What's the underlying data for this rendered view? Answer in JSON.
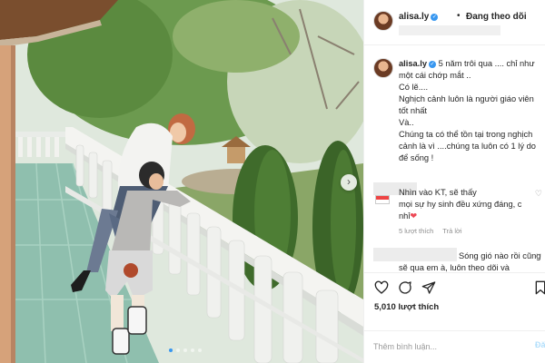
{
  "post": {
    "username": "alisa.ly",
    "separator": "•",
    "follow_status": "Đang theo dõi",
    "caption_lines": [
      "5 năm trôi qua .... chỉ như",
      "một cái chớp mắt ..",
      "Có lẽ....",
      "Nghịch cảnh luôn là người giáo viên",
      "tốt nhất",
      "Và..",
      "Chúng ta có thể tồn tại trong nghịch",
      "cảnh là vì ....chúng ta luôn có 1 lý do",
      "để sống !"
    ],
    "likes": "5,010 lượt thích"
  },
  "comments": [
    {
      "lines": [
        "Nhìn vào KT, sẽ thấy",
        "mọi sự hy sinh đều xứng đáng, c",
        "nhỉ"
      ],
      "heart": "❤",
      "likes_label": "5 lượt thích",
      "reply_label": "Trả lời"
    },
    {
      "lines": [
        "Sóng gió nào rồi cũng",
        "sẽ qua em à, luôn theo dõi và"
      ]
    }
  ],
  "actions": {
    "like_icon": "heart-outline-icon",
    "comment_icon": "comment-icon",
    "share_icon": "send-icon",
    "save_icon": "bookmark-icon"
  },
  "add_comment": {
    "placeholder": "Thêm bình luận...",
    "post_label": "Đă"
  },
  "carousel": {
    "next_arrow": "›",
    "dot_count": 5,
    "active_index": 0
  },
  "colors": {
    "verified": "#3897f0",
    "heart": "#ed4956",
    "post_button_disabled": "#b2dffc",
    "meta_text": "#8e8e8e"
  }
}
